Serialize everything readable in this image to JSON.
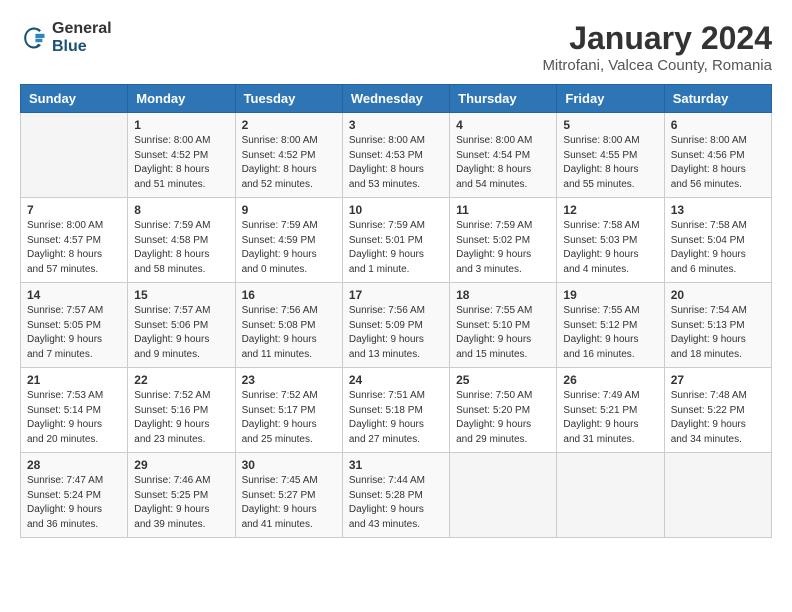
{
  "header": {
    "logo_general": "General",
    "logo_blue": "Blue",
    "month_title": "January 2024",
    "location": "Mitrofani, Valcea County, Romania"
  },
  "calendar": {
    "days_of_week": [
      "Sunday",
      "Monday",
      "Tuesday",
      "Wednesday",
      "Thursday",
      "Friday",
      "Saturday"
    ],
    "weeks": [
      [
        {
          "day": "",
          "sunrise": "",
          "sunset": "",
          "daylight": ""
        },
        {
          "day": "1",
          "sunrise": "Sunrise: 8:00 AM",
          "sunset": "Sunset: 4:52 PM",
          "daylight": "Daylight: 8 hours and 51 minutes."
        },
        {
          "day": "2",
          "sunrise": "Sunrise: 8:00 AM",
          "sunset": "Sunset: 4:52 PM",
          "daylight": "Daylight: 8 hours and 52 minutes."
        },
        {
          "day": "3",
          "sunrise": "Sunrise: 8:00 AM",
          "sunset": "Sunset: 4:53 PM",
          "daylight": "Daylight: 8 hours and 53 minutes."
        },
        {
          "day": "4",
          "sunrise": "Sunrise: 8:00 AM",
          "sunset": "Sunset: 4:54 PM",
          "daylight": "Daylight: 8 hours and 54 minutes."
        },
        {
          "day": "5",
          "sunrise": "Sunrise: 8:00 AM",
          "sunset": "Sunset: 4:55 PM",
          "daylight": "Daylight: 8 hours and 55 minutes."
        },
        {
          "day": "6",
          "sunrise": "Sunrise: 8:00 AM",
          "sunset": "Sunset: 4:56 PM",
          "daylight": "Daylight: 8 hours and 56 minutes."
        }
      ],
      [
        {
          "day": "7",
          "sunrise": "Sunrise: 8:00 AM",
          "sunset": "Sunset: 4:57 PM",
          "daylight": "Daylight: 8 hours and 57 minutes."
        },
        {
          "day": "8",
          "sunrise": "Sunrise: 7:59 AM",
          "sunset": "Sunset: 4:58 PM",
          "daylight": "Daylight: 8 hours and 58 minutes."
        },
        {
          "day": "9",
          "sunrise": "Sunrise: 7:59 AM",
          "sunset": "Sunset: 4:59 PM",
          "daylight": "Daylight: 9 hours and 0 minutes."
        },
        {
          "day": "10",
          "sunrise": "Sunrise: 7:59 AM",
          "sunset": "Sunset: 5:01 PM",
          "daylight": "Daylight: 9 hours and 1 minute."
        },
        {
          "day": "11",
          "sunrise": "Sunrise: 7:59 AM",
          "sunset": "Sunset: 5:02 PM",
          "daylight": "Daylight: 9 hours and 3 minutes."
        },
        {
          "day": "12",
          "sunrise": "Sunrise: 7:58 AM",
          "sunset": "Sunset: 5:03 PM",
          "daylight": "Daylight: 9 hours and 4 minutes."
        },
        {
          "day": "13",
          "sunrise": "Sunrise: 7:58 AM",
          "sunset": "Sunset: 5:04 PM",
          "daylight": "Daylight: 9 hours and 6 minutes."
        }
      ],
      [
        {
          "day": "14",
          "sunrise": "Sunrise: 7:57 AM",
          "sunset": "Sunset: 5:05 PM",
          "daylight": "Daylight: 9 hours and 7 minutes."
        },
        {
          "day": "15",
          "sunrise": "Sunrise: 7:57 AM",
          "sunset": "Sunset: 5:06 PM",
          "daylight": "Daylight: 9 hours and 9 minutes."
        },
        {
          "day": "16",
          "sunrise": "Sunrise: 7:56 AM",
          "sunset": "Sunset: 5:08 PM",
          "daylight": "Daylight: 9 hours and 11 minutes."
        },
        {
          "day": "17",
          "sunrise": "Sunrise: 7:56 AM",
          "sunset": "Sunset: 5:09 PM",
          "daylight": "Daylight: 9 hours and 13 minutes."
        },
        {
          "day": "18",
          "sunrise": "Sunrise: 7:55 AM",
          "sunset": "Sunset: 5:10 PM",
          "daylight": "Daylight: 9 hours and 15 minutes."
        },
        {
          "day": "19",
          "sunrise": "Sunrise: 7:55 AM",
          "sunset": "Sunset: 5:12 PM",
          "daylight": "Daylight: 9 hours and 16 minutes."
        },
        {
          "day": "20",
          "sunrise": "Sunrise: 7:54 AM",
          "sunset": "Sunset: 5:13 PM",
          "daylight": "Daylight: 9 hours and 18 minutes."
        }
      ],
      [
        {
          "day": "21",
          "sunrise": "Sunrise: 7:53 AM",
          "sunset": "Sunset: 5:14 PM",
          "daylight": "Daylight: 9 hours and 20 minutes."
        },
        {
          "day": "22",
          "sunrise": "Sunrise: 7:52 AM",
          "sunset": "Sunset: 5:16 PM",
          "daylight": "Daylight: 9 hours and 23 minutes."
        },
        {
          "day": "23",
          "sunrise": "Sunrise: 7:52 AM",
          "sunset": "Sunset: 5:17 PM",
          "daylight": "Daylight: 9 hours and 25 minutes."
        },
        {
          "day": "24",
          "sunrise": "Sunrise: 7:51 AM",
          "sunset": "Sunset: 5:18 PM",
          "daylight": "Daylight: 9 hours and 27 minutes."
        },
        {
          "day": "25",
          "sunrise": "Sunrise: 7:50 AM",
          "sunset": "Sunset: 5:20 PM",
          "daylight": "Daylight: 9 hours and 29 minutes."
        },
        {
          "day": "26",
          "sunrise": "Sunrise: 7:49 AM",
          "sunset": "Sunset: 5:21 PM",
          "daylight": "Daylight: 9 hours and 31 minutes."
        },
        {
          "day": "27",
          "sunrise": "Sunrise: 7:48 AM",
          "sunset": "Sunset: 5:22 PM",
          "daylight": "Daylight: 9 hours and 34 minutes."
        }
      ],
      [
        {
          "day": "28",
          "sunrise": "Sunrise: 7:47 AM",
          "sunset": "Sunset: 5:24 PM",
          "daylight": "Daylight: 9 hours and 36 minutes."
        },
        {
          "day": "29",
          "sunrise": "Sunrise: 7:46 AM",
          "sunset": "Sunset: 5:25 PM",
          "daylight": "Daylight: 9 hours and 39 minutes."
        },
        {
          "day": "30",
          "sunrise": "Sunrise: 7:45 AM",
          "sunset": "Sunset: 5:27 PM",
          "daylight": "Daylight: 9 hours and 41 minutes."
        },
        {
          "day": "31",
          "sunrise": "Sunrise: 7:44 AM",
          "sunset": "Sunset: 5:28 PM",
          "daylight": "Daylight: 9 hours and 43 minutes."
        },
        {
          "day": "",
          "sunrise": "",
          "sunset": "",
          "daylight": ""
        },
        {
          "day": "",
          "sunrise": "",
          "sunset": "",
          "daylight": ""
        },
        {
          "day": "",
          "sunrise": "",
          "sunset": "",
          "daylight": ""
        }
      ]
    ]
  }
}
